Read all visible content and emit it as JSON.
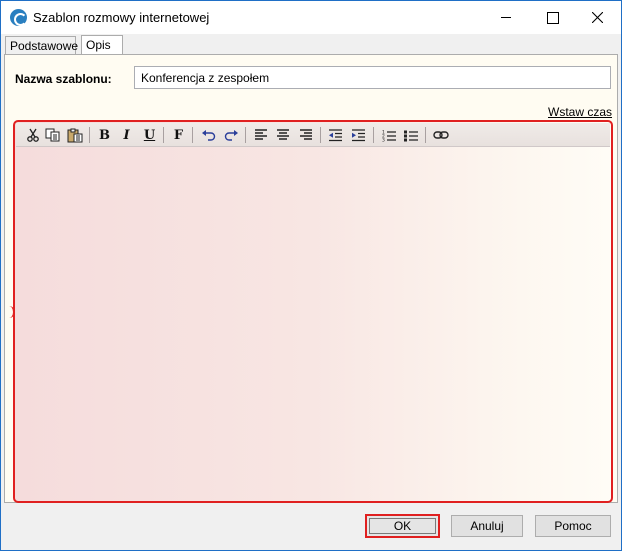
{
  "window": {
    "title": "Szablon rozmowy internetowej",
    "accent": "#1f6fc6"
  },
  "tabs": [
    {
      "label": "Podstawowe",
      "active": false
    },
    {
      "label": "Opis",
      "active": true
    }
  ],
  "form": {
    "name_label": "Nazwa szablonu:",
    "name_value": "Konferencja z zespołem",
    "insert_time_link": "Wstaw czas"
  },
  "editor": {
    "highlight_color": "#e02020",
    "content": "",
    "toolbar": [
      {
        "icon": "cut-icon"
      },
      {
        "icon": "copy-icon"
      },
      {
        "icon": "paste-icon"
      },
      {
        "icon": "bold-icon",
        "glyph": "B"
      },
      {
        "icon": "italic-icon",
        "glyph": "I"
      },
      {
        "icon": "underline-icon",
        "glyph": "U"
      },
      {
        "icon": "font-icon",
        "glyph": "F"
      },
      {
        "icon": "undo-icon"
      },
      {
        "icon": "redo-icon"
      },
      {
        "icon": "align-left-icon"
      },
      {
        "icon": "align-center-icon"
      },
      {
        "icon": "align-right-icon"
      },
      {
        "icon": "outdent-icon"
      },
      {
        "icon": "indent-icon"
      },
      {
        "icon": "numbered-list-icon"
      },
      {
        "icon": "bullet-list-icon"
      },
      {
        "icon": "link-icon"
      }
    ]
  },
  "buttons": {
    "ok": "OK",
    "cancel": "Anuluj",
    "help": "Pomoc"
  }
}
